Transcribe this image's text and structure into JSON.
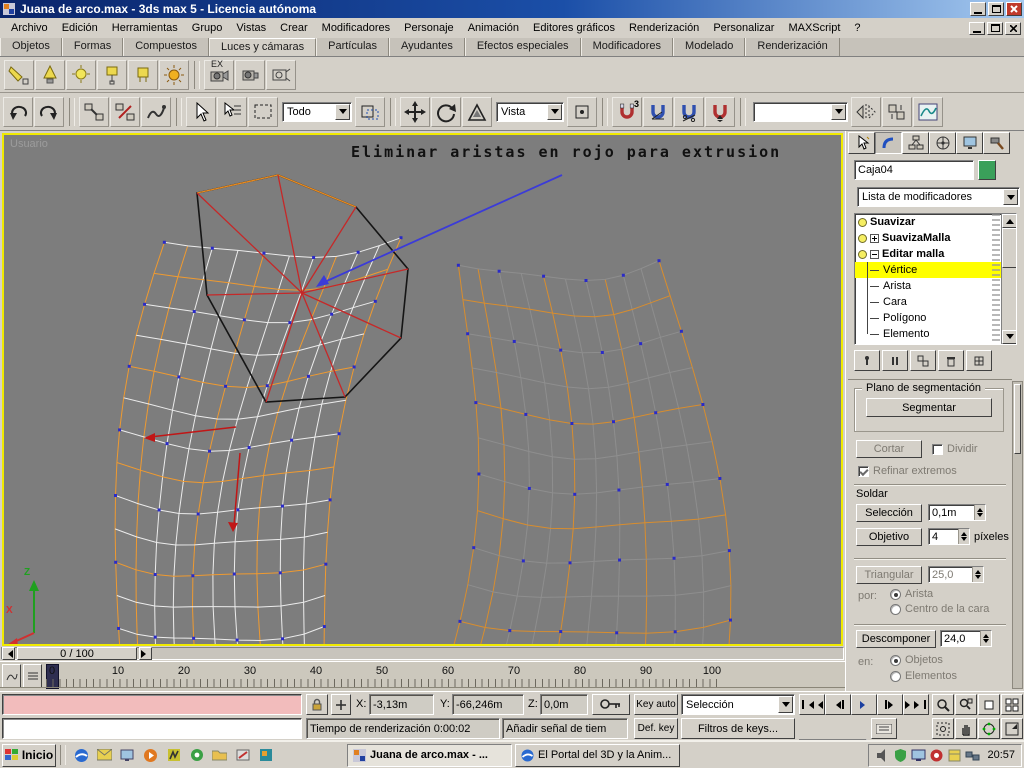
{
  "titlebar": {
    "title": "Juana de arco.max - 3ds max 5 - Licencia autónoma"
  },
  "menubar": {
    "items": [
      "Archivo",
      "Edición",
      "Herramientas",
      "Grupo",
      "Vistas",
      "Crear",
      "Modificadores",
      "Personaje",
      "Animación",
      "Editores gráficos",
      "Renderización",
      "Personalizar",
      "MAXScript",
      "?"
    ]
  },
  "tabbar": {
    "items": [
      "Objetos",
      "Formas",
      "Compuestos",
      "Luces y cámaras",
      "Partículas",
      "Ayudantes",
      "Efectos especiales",
      "Modificadores",
      "Modelado",
      "Renderización"
    ],
    "active": "Luces y cámaras"
  },
  "toolbar_lights": {
    "ex_label": "EX"
  },
  "toolbar_main": {
    "selection_filter_value": "Todo",
    "coord_system_value": "Vista",
    "named_selection_value": "",
    "snap_badge": "3"
  },
  "viewport": {
    "label": "Usuario",
    "annotation": "Eliminar aristas en rojo para extrusion",
    "axis_x_label": "X",
    "axis_z_label": "Z"
  },
  "time_slider": {
    "value": "0 / 100"
  },
  "ruler": {
    "ticks": [
      "0",
      "10",
      "20",
      "30",
      "40",
      "50",
      "60",
      "70",
      "80",
      "90",
      "100"
    ]
  },
  "command_panel": {
    "object_name": "Caja04",
    "object_color": "#3aa05a",
    "modifier_dropdown_label": "Lista de modificadores",
    "stack": [
      {
        "label": "Suavizar"
      },
      {
        "label": "SuavizaMalla"
      },
      {
        "label": "Editar malla",
        "expanded": true
      },
      {
        "label": "Vértice",
        "selected": true
      },
      {
        "label": "Arista"
      },
      {
        "label": "Cara"
      },
      {
        "label": "Polígono"
      },
      {
        "label": "Elemento"
      }
    ],
    "rollout": {
      "plano_segmentacion": "Plano de segmentación",
      "segmentar": "Segmentar",
      "cortar": "Cortar",
      "dividir": "Dividir",
      "refinar_extremos": "Refinar extremos",
      "soldar": "Soldar",
      "seleccion": "Selección",
      "seleccion_value": "0,1m",
      "objetivo": "Objetivo",
      "objetivo_value": "4",
      "pixeles": "píxeles",
      "triangular": "Triangular",
      "triangular_value": "25,0",
      "por": "por:",
      "arista": "Arista",
      "centro_cara": "Centro de la cara",
      "descomponer": "Descomponer",
      "descomponer_value": "24,0",
      "en": "en:",
      "objetos": "Objetos",
      "elementos": "Elementos"
    }
  },
  "statusbar": {
    "x_label": "X:",
    "x_value": "-3,13m",
    "y_label": "Y:",
    "y_value": "-66,246m",
    "z_label": "Z:",
    "z_value": "0,0m",
    "key_auto_label": "Key auto",
    "selection_set_value": "Selección",
    "def_key_label": "Def. key",
    "key_filters_label": "Filtros de keys...",
    "render_time_text": "Tiempo de renderización  0:00:02",
    "prompt_text": "Añadir señal de tiem",
    "frame_value": "0"
  },
  "taskbar": {
    "start_label": "Inicio",
    "task1_label": "Juana de arco.max - ...",
    "task2_label": "El Portal del 3D y la Anim...",
    "clock": "20:57"
  },
  "colors": {
    "accent_orange": "#e8952f",
    "selection_yellow": "#ffff00",
    "viewport_border": "#f0ea00"
  }
}
